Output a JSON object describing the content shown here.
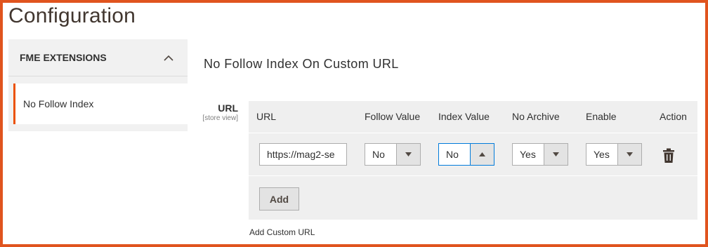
{
  "page": {
    "title": "Configuration"
  },
  "sidebar": {
    "section_title": "FME EXTENSIONS",
    "items": [
      {
        "label": "No Follow Index",
        "active": true
      }
    ]
  },
  "main": {
    "section_title": "No Follow Index On Custom URL",
    "field": {
      "label": "URL",
      "scope": "[store view]"
    },
    "grid": {
      "columns": [
        "URL",
        "Follow Value",
        "Index Value",
        "No Archive",
        "Enable",
        "Action"
      ],
      "rows": [
        {
          "url": "https://mag2-se",
          "follow_value": "No",
          "index_value": "No",
          "no_archive": "Yes",
          "enable": "Yes",
          "action_icon": "trash-icon"
        }
      ],
      "add_label": "Add"
    },
    "note": "Add Custom URL"
  },
  "colors": {
    "frame": "#e0541e",
    "accent": "#eb5202",
    "focus": "#007bdb",
    "grid_bg": "#efefef"
  }
}
